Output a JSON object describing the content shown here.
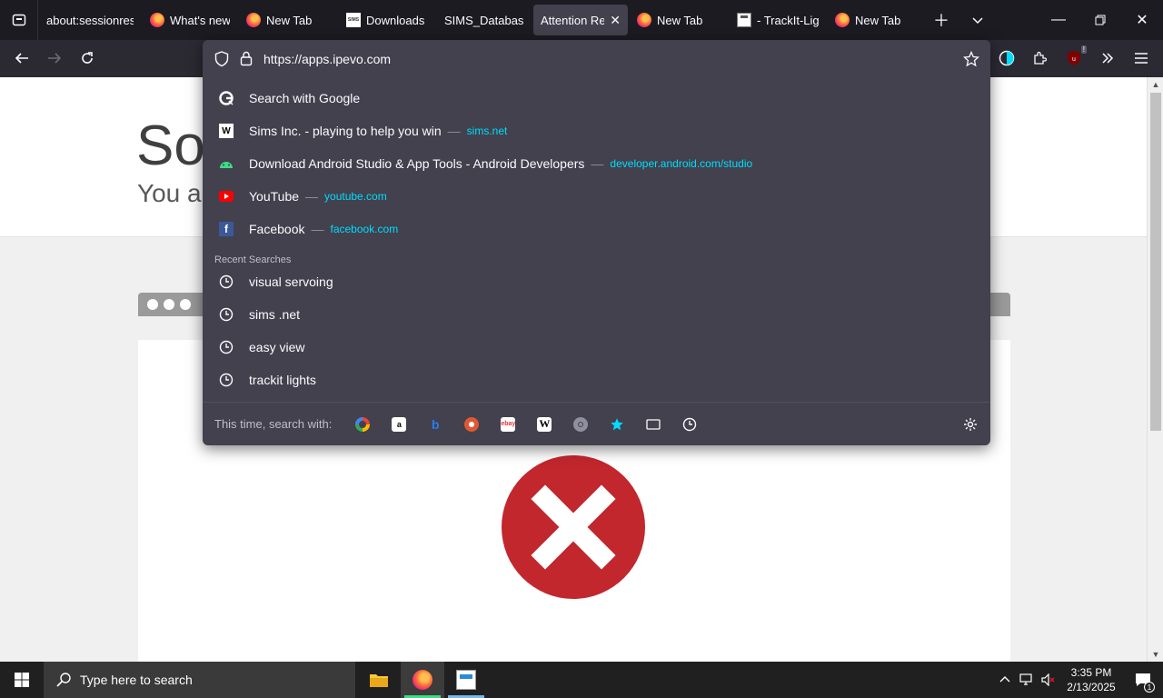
{
  "tabs": [
    {
      "title": "about:sessionres",
      "favicon": "none"
    },
    {
      "title": "What's new",
      "favicon": "firefox"
    },
    {
      "title": "New Tab",
      "favicon": "firefox"
    },
    {
      "title": "Downloads |",
      "favicon": "sims"
    },
    {
      "title": "SIMS_Database_",
      "favicon": "none"
    },
    {
      "title": "Attention Req",
      "favicon": "none",
      "active": true
    },
    {
      "title": "New Tab",
      "favicon": "firefox"
    },
    {
      "title": "- TrackIt-Ligt",
      "favicon": "trackit"
    },
    {
      "title": "New Tab",
      "favicon": "firefox"
    }
  ],
  "urlbar": {
    "url": "https://apps.ipevo.com"
  },
  "suggestions": [
    {
      "title": "Search with Google",
      "url": "",
      "icon": "google-icon"
    },
    {
      "title": "Sims Inc. - playing to help you win",
      "url": "sims.net",
      "icon": "sims-icon"
    },
    {
      "title": "Download Android Studio & App Tools - Android Developers",
      "url": "developer.android.com/studio",
      "icon": "android-icon"
    },
    {
      "title": "YouTube",
      "url": "youtube.com",
      "icon": "youtube-icon"
    },
    {
      "title": "Facebook",
      "url": "facebook.com",
      "icon": "facebook-icon"
    }
  ],
  "recent_label": "Recent Searches",
  "recent_searches": [
    "visual servoing",
    "sims .net",
    "easy view",
    "trackit lights"
  ],
  "oneoff": {
    "label": "This time, search with:",
    "engines": [
      "google",
      "amazon",
      "bing",
      "duckduckgo",
      "ebay",
      "wikipedia",
      "search",
      "bookmarks",
      "tabs",
      "history"
    ]
  },
  "page": {
    "heading": "Sor",
    "subheading": "You a"
  },
  "taskbar": {
    "search_placeholder": "Type here to search",
    "time": "3:35 PM",
    "date": "2/13/2025",
    "notifications": "1"
  },
  "extension_badge": "!",
  "colors": {
    "accent_url": "#00ddff",
    "error_red": "#c1272d",
    "toolbar_bg": "#2b2a33",
    "popup_bg": "#42414d"
  }
}
